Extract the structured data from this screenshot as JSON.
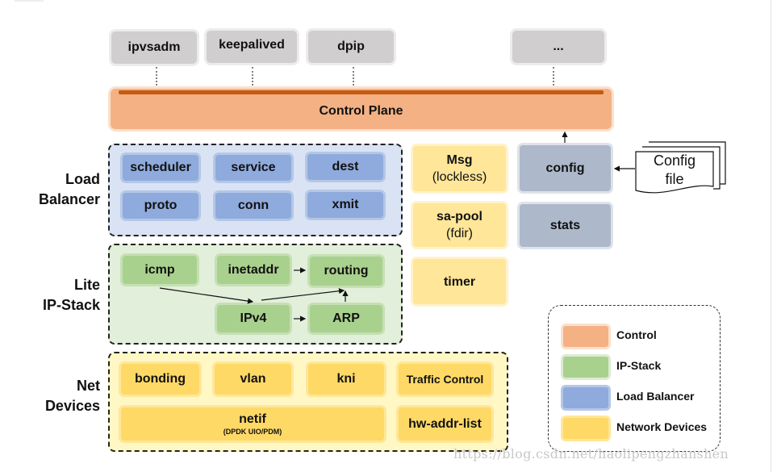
{
  "top_tools": [
    "ipvsadm",
    "keepalived",
    "dpip",
    "..."
  ],
  "control_plane": {
    "label": "Control Plane"
  },
  "groups": {
    "load_balancer": {
      "label_line1": "Load",
      "label_line2": "Balancer",
      "modules": [
        "scheduler",
        "service",
        "dest",
        "proto",
        "conn",
        "xmit"
      ]
    },
    "ip_stack": {
      "label_line1": "Lite",
      "label_line2": "IP-Stack",
      "modules": {
        "icmp": "icmp",
        "inetaddr": "inetaddr",
        "routing": "routing",
        "ipv4": "IPv4",
        "arp": "ARP"
      },
      "edges": [
        [
          "icmp",
          "ipv4"
        ],
        [
          "inetaddr",
          "routing"
        ],
        [
          "ipv4",
          "routing"
        ],
        [
          "ipv4",
          "arp"
        ],
        [
          "arp",
          "routing"
        ]
      ]
    },
    "net_devices": {
      "label_line1": "Net",
      "label_line2": "Devices",
      "modules": {
        "bonding": "bonding",
        "vlan": "vlan",
        "kni": "kni",
        "traffic_control": "Traffic Control",
        "netif": "netif",
        "netif_sub": "(DPDK UIO/PDM)",
        "hw_addr_list": "hw-addr-list"
      }
    }
  },
  "misc_modules": {
    "msg": {
      "title": "Msg",
      "sub": "(lockless)"
    },
    "sa_pool": {
      "title": "sa-pool",
      "sub": "(fdir)"
    },
    "timer": {
      "title": "timer"
    }
  },
  "config": {
    "label": "config"
  },
  "stats": {
    "label": "stats"
  },
  "config_file": {
    "line1": "Config",
    "line2": "file"
  },
  "legend": {
    "items": [
      {
        "label": "Control",
        "color": "#f4b183"
      },
      {
        "label": "IP-Stack",
        "color": "#a9d18e"
      },
      {
        "label": "Load Balancer",
        "color": "#8faadc"
      },
      {
        "label": "Network Devices",
        "color": "#ffd966"
      }
    ]
  },
  "watermark": "https://blog.csdn.net/haolipengzhanshen"
}
